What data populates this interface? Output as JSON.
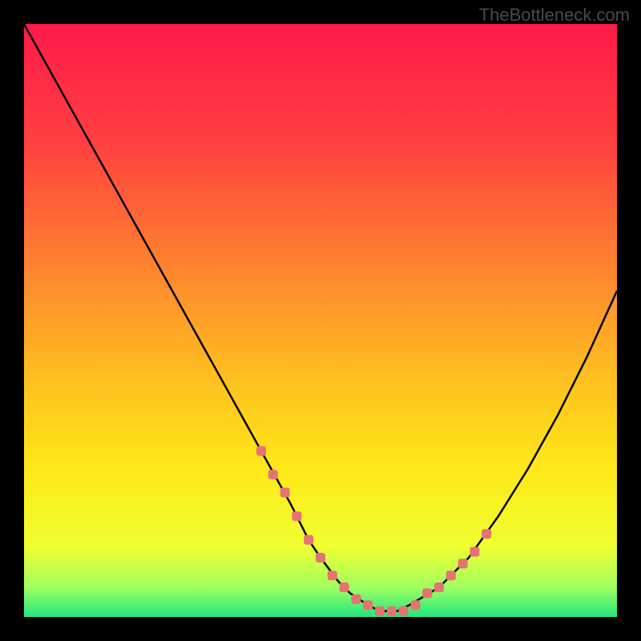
{
  "watermark": "TheBottleneck.com",
  "chart_data": {
    "type": "line",
    "title": "",
    "xlabel": "",
    "ylabel": "",
    "xlim": [
      0,
      100
    ],
    "ylim": [
      0,
      100
    ],
    "series": [
      {
        "name": "bottleneck-curve",
        "x": [
          0,
          5,
          10,
          15,
          20,
          25,
          30,
          35,
          40,
          45,
          48,
          50,
          53,
          55,
          58,
          60,
          63,
          65,
          70,
          75,
          80,
          85,
          90,
          95,
          100
        ],
        "values": [
          100,
          91,
          82,
          73,
          64,
          55,
          46,
          37,
          28,
          19,
          13,
          10,
          6,
          4,
          2,
          1,
          1,
          2,
          5,
          10,
          17,
          25,
          34,
          44,
          55
        ]
      },
      {
        "name": "highlight-markers",
        "x": [
          40,
          42,
          44,
          46,
          48,
          50,
          52,
          54,
          56,
          58,
          60,
          62,
          64,
          66,
          68,
          70,
          72,
          74,
          76,
          78
        ],
        "values": [
          28,
          24,
          21,
          17,
          13,
          10,
          7,
          5,
          3,
          2,
          1,
          1,
          1,
          2,
          4,
          5,
          7,
          9,
          11,
          14
        ]
      }
    ],
    "gradient_stops": [
      {
        "offset": 0,
        "color": "#ff1a4a"
      },
      {
        "offset": 20,
        "color": "#ff4040"
      },
      {
        "offset": 40,
        "color": "#ff8030"
      },
      {
        "offset": 60,
        "color": "#ffc020"
      },
      {
        "offset": 75,
        "color": "#ffe818"
      },
      {
        "offset": 88,
        "color": "#f0ff30"
      },
      {
        "offset": 95,
        "color": "#a0ff60"
      },
      {
        "offset": 100,
        "color": "#20e880"
      }
    ]
  }
}
